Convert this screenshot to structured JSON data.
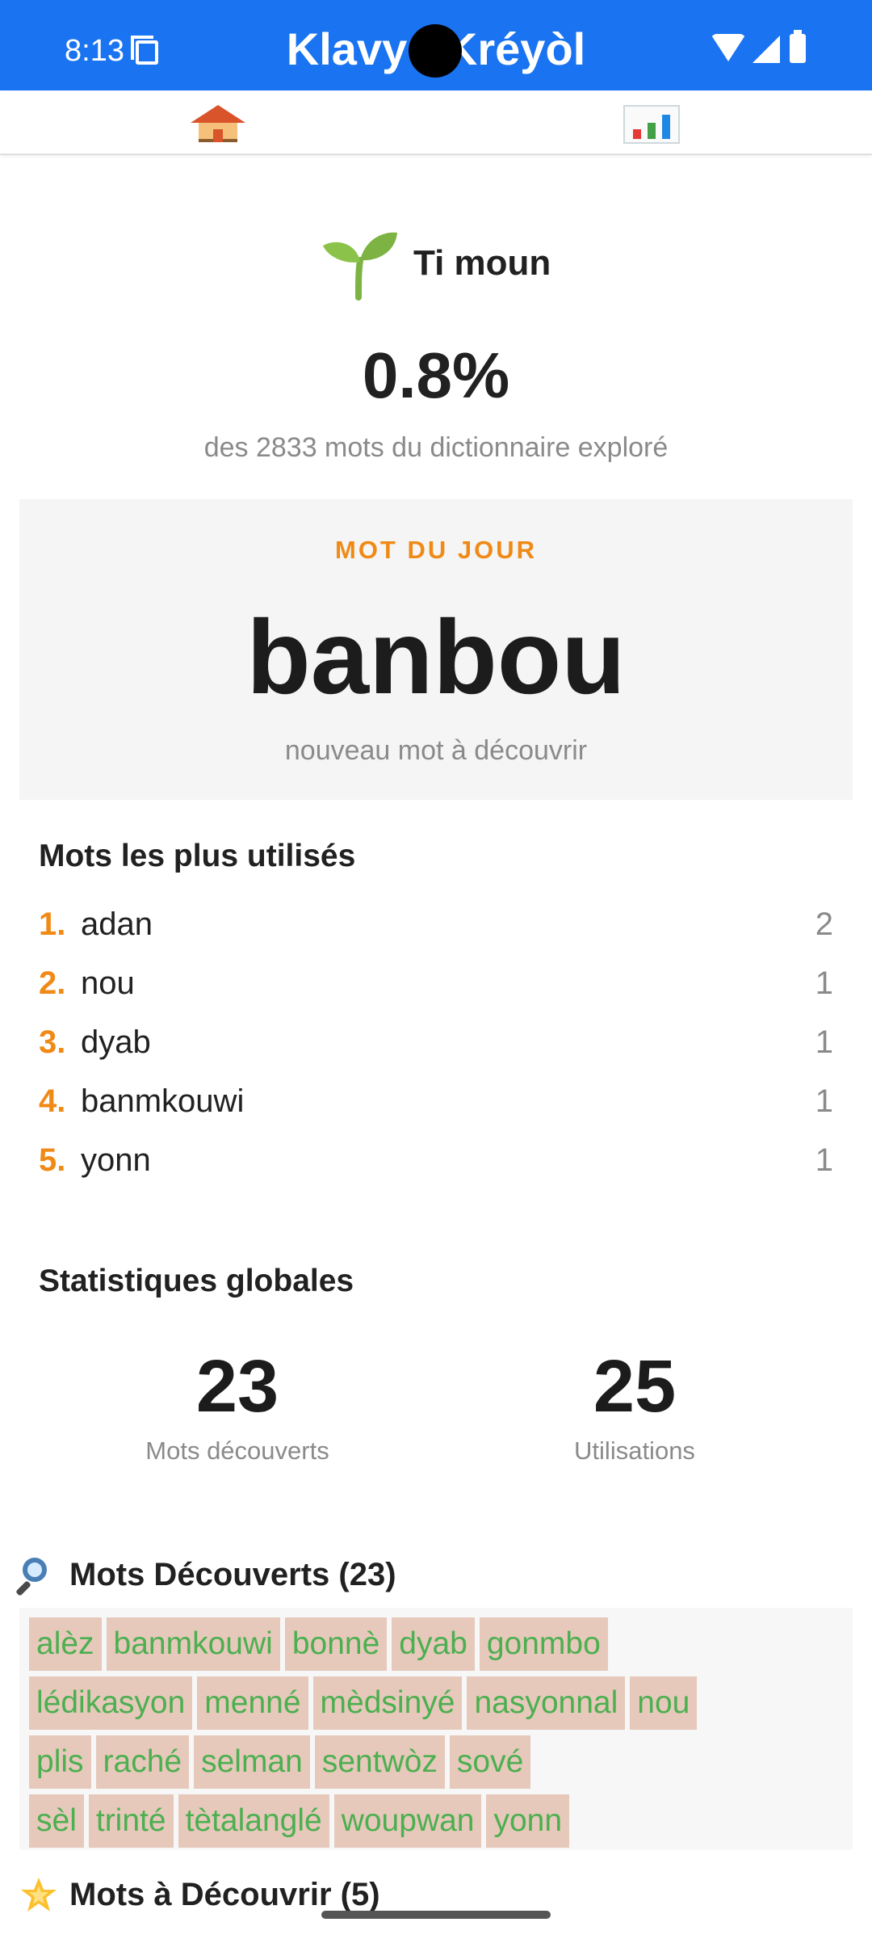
{
  "status_bar": {
    "time": "8:13"
  },
  "app": {
    "title": "Klavyé Kréyòl"
  },
  "tabs": [
    {
      "name": "home",
      "icon": "house-icon",
      "selected": true
    },
    {
      "name": "stats",
      "icon": "bar-chart-icon",
      "selected": false
    }
  ],
  "level": {
    "icon": "seedling-icon",
    "name": "Ti moun",
    "percent": "0.8%",
    "explored_text": "des 2833 mots du dictionnaire exploré"
  },
  "word_of_day": {
    "label": "MOT DU JOUR",
    "word": "banbou",
    "subtitle": "nouveau mot à découvrir"
  },
  "top_words": {
    "title": "Mots les plus utilisés",
    "items": [
      {
        "rank": "1.",
        "word": "adan",
        "count": "2"
      },
      {
        "rank": "2.",
        "word": "nou",
        "count": "1"
      },
      {
        "rank": "3.",
        "word": "dyab",
        "count": "1"
      },
      {
        "rank": "4.",
        "word": "banmkouwi",
        "count": "1"
      },
      {
        "rank": "5.",
        "word": "yonn",
        "count": "1"
      }
    ]
  },
  "global_stats": {
    "title": "Statistiques globales",
    "discovered_value": "23",
    "discovered_label": "Mots découverts",
    "usages_value": "25",
    "usages_label": "Utilisations"
  },
  "discovered": {
    "icon": "magnifier-icon",
    "title": "Mots Découverts (23)",
    "rows": [
      [
        "alèz",
        "banmkouwi",
        "bonnè",
        "dyab",
        "gonmbo"
      ],
      [
        "lédikasyon",
        "menné",
        "mèdsinyé",
        "nasyonnal",
        "nou"
      ],
      [
        "plis",
        "raché",
        "selman",
        "sentwòz",
        "sové"
      ],
      [
        "sèl",
        "trinté",
        "tètalanglé",
        "woupwan",
        "yonn"
      ]
    ]
  },
  "to_discover": {
    "icon": "star-icon",
    "title": "Mots à Découvrir (5)"
  },
  "colors": {
    "app_bar": "#1a73f0",
    "accent_orange": "#f08a16",
    "chip_bg": "#e6c9bb",
    "chip_text": "#4caf50"
  }
}
